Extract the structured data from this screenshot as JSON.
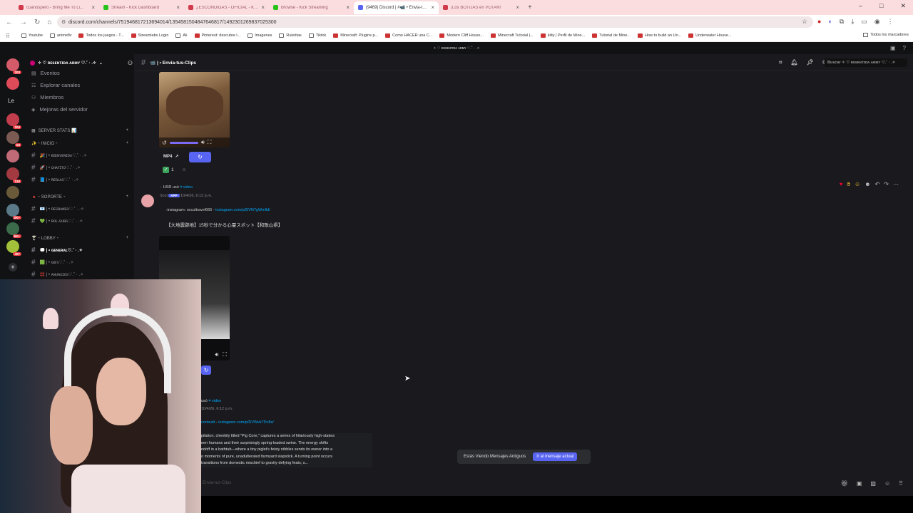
{
  "browser": {
    "tabs": [
      {
        "title": "cuanospero - Bring Me To Li...",
        "color": "#d03a4a",
        "active": false
      },
      {
        "title": "Stream - Kick Dashboard",
        "color": "#27c21a",
        "active": false
      },
      {
        "title": "¿ESCONDIDAS - OFICIAL - Ki...",
        "color": "#d03a4a",
        "active": false
      },
      {
        "title": "Browse - Kick Streaming",
        "color": "#27c21a",
        "active": false
      },
      {
        "title": "(9469) Discord | #📹 • Envia-tu...",
        "color": "#5865f2",
        "active": true
      },
      {
        "title": "¡Los BOTIJAS en VOTAN!",
        "color": "#d03a4a",
        "active": false
      }
    ],
    "url": "discord.com/channels/751946817213694014/1354581504847646817/1492301269837025300",
    "bookmarks": [
      "Youtube",
      "animeflv",
      "Todos los juegos - T...",
      "Streamlabs Login",
      "Ali",
      "Pinterest: descubre l...",
      "Imagenes",
      "Ruletitas",
      "Tiktok",
      "Minecraft: Plugins p...",
      "Como HACER una C...",
      "Modern Cliff House...",
      "Minecraft Tutorial |...",
      "kitty | Perfil de Mine...",
      "Tutorial de Mine...",
      "How to build an Un...",
      "Underwater House..."
    ],
    "bookmarks_right": "Todos los marcadores"
  },
  "discord": {
    "window_title": "✧ ♡ ʀᴇsᴇɴᴛɪᴅᴀ ᴀʀᴍʏ ♡.˚ · .✧",
    "guilds": [
      {
        "badge": "203",
        "color": "#d35b6a"
      },
      {
        "badge": "",
        "color": "#e04b5a"
      },
      {
        "text": "Le"
      },
      {
        "badge": "104",
        "color": "#c23e4d"
      },
      {
        "badge": "53",
        "color": "#7a5a52"
      },
      {
        "badge": "",
        "color": "#c06a78"
      },
      {
        "badge": "134",
        "color": "#a33a42"
      },
      {
        "badge": "",
        "color": "#6a5a3a"
      },
      {
        "badge": "2K+",
        "color": "#5a7a8a"
      },
      {
        "badge": "5K+",
        "color": "#3a6a4a"
      },
      {
        "badge": "407",
        "color": "#a3c03a"
      }
    ],
    "server": {
      "name": "✧ ♡ ʀᴇsᴇɴᴛɪᴅᴀ ᴀʀᴍʏ ♡.˚ · .✧",
      "top_items": [
        "Eventos",
        "Explorar canales",
        "Miembros",
        "Mejoras del servidor"
      ],
      "server_stats": "SERVER STATS 📊",
      "categories": [
        {
          "name": "✨ ⁃ INICIO ⁃",
          "channels": [
            "🎉 | • ʙɪᴇɴᴠᴇɴɪᴅᴀ♡.˚ · .✧",
            "🚀 | • ᴄʜᴀᴛɪᴛᴏ♡.˚ · .✧",
            "📘 | • ʀᴇɢʟᴀs♡.˚ · .✧"
          ]
        },
        {
          "name": "🔺 ⁃ SOPORTE ⁃",
          "channels": [
            "📧 | • ᴅᴇsʙᴀɴᴇᴏ♡.˚ · .✧",
            "💚 | • ʀᴏʟ-sᴜʙs♡.˚ · .✧"
          ]
        },
        {
          "name": "🍸 ⁃ LOBBY ⁃",
          "channels": [
            "💭 | • ɢᴇɴᴇʀᴀʟ♡.˚ · .✧",
            "🟩 | • ɢɪғs♡.˚ · .✧",
            "💢 | • ᴀɴᴜɴᴄɪᴏs♡.˚ · .✧"
          ]
        }
      ]
    },
    "channel": {
      "name": "📹 | • Envia-tus-Clips",
      "search_placeholder": "Buscar ✧ ♡ ʀᴇsᴇɴᴛɪᴅᴀ ᴀʀᴍʏ ♡.˚ · .✧"
    },
    "messages": {
      "m1": {
        "format": "MP4",
        "reaction_count": "1"
      },
      "m2": {
        "reply_user": "HSR",
        "reply_action": "usó",
        "reply_cmd": "⌗ video",
        "author": "Soci",
        "app_tag": "APP",
        "timestamp": "10/4/26, 6:12 p.m.",
        "source_user": ":instagram: occultravel666",
        "source_link": "instagram.com/p/DVN7gWmlld/",
        "caption": "【大地震跡地】15秒で分かる心霊スポット【和歌山県】"
      },
      "m3": {
        "reply_action": "usó",
        "reply_cmd": "⌗ video",
        "timestamp": "10/4/26, 6:12 p.m.",
        "source_user": "contextt",
        "source_link": "instagram.com/p/DVWvk7Dc8x/",
        "lines": [
          "pilation, cheekily titled \"Pig Core,\" captures a series of hilariously high-stakes",
          "een humans and their surprisingly spring-loaded swine. The energy shifts",
          "ndoff in a bathtub—where a tiny piglet's feisty nibbles sends its owner into a",
          "o moments of pure, unadulterated farmyard slapstick. A turning point occurs",
          "transitions from domestic mischief to gravity-defying feats; s..."
        ]
      }
    },
    "toast": {
      "text": "Estás Viendo Mensajes Antiguos",
      "button": "Ir al mensaje actual"
    },
    "composer_placeholder": "Envia-tus-Clips"
  }
}
